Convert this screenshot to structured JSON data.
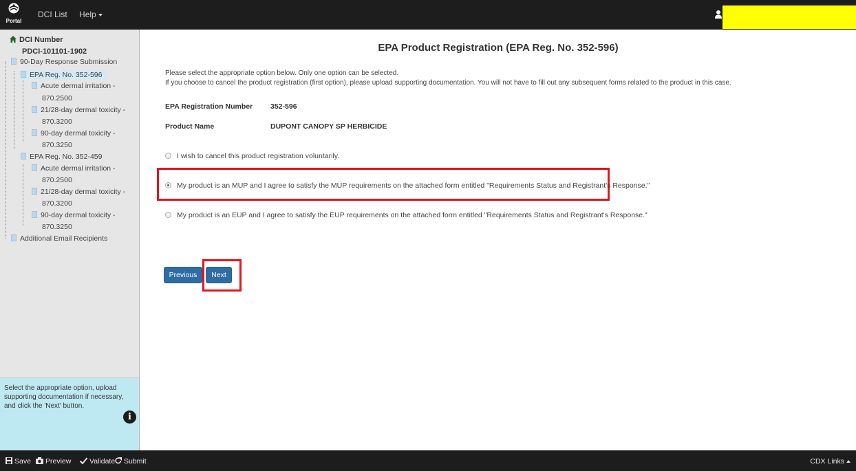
{
  "header": {
    "logo_text": "Portal",
    "nav": [
      {
        "label": "DCI List"
      },
      {
        "label": "Help"
      }
    ]
  },
  "tree": {
    "root_label": "DCI Number",
    "dci_id": "PDCI-101101-1902",
    "submission_label": "90-Day Response Submission",
    "reg1": {
      "label": "EPA Reg. No. 352-596",
      "items": [
        {
          "line1": "Acute dermal irritation -",
          "line2": "870.2500"
        },
        {
          "line1": "21/28-day dermal toxicity -",
          "line2": "870.3200"
        },
        {
          "line1": "90-day dermal toxicity -",
          "line2": "870.3250"
        }
      ]
    },
    "reg2": {
      "label": "EPA Reg. No. 352-459",
      "items": [
        {
          "line1": "Acute dermal irritation -",
          "line2": "870.2500"
        },
        {
          "line1": "21/28-day dermal toxicity -",
          "line2": "870.3200"
        },
        {
          "line1": "90-day dermal toxicity -",
          "line2": "870.3250"
        }
      ]
    },
    "additional_label": "Additional Email Recipients"
  },
  "help": {
    "text": "Select the appropriate option, upload supporting documentation if necessary, and click the 'Next' button.",
    "icon": "info-icon"
  },
  "main": {
    "title": "EPA Product Registration (EPA Reg. No. 352-596)",
    "intro_line1": "Please select the appropriate option below. Only one option can be selected.",
    "intro_line2": "If you choose to cancel the product registration (first option), please upload supporting documentation. You will not have to fill out any subsequent forms related to the product in this case.",
    "reg_number_label": "EPA Registration Number",
    "reg_number_value": "352-596",
    "product_name_label": "Product Name",
    "product_name_value": "DUPONT CANOPY SP HERBICIDE",
    "options": [
      {
        "label": "I wish to cancel this product registration voluntarily.",
        "checked": false
      },
      {
        "label": "My product is an MUP and I agree to satisfy the MUP requirements on the attached form entitled \"Requirements Status and Registrant's Response.\"",
        "checked": true
      },
      {
        "label": "My product is an EUP and I agree to satisfy the EUP requirements on the attached form entitled \"Requirements Status and Registrant's Response.\"",
        "checked": false
      }
    ],
    "previous_label": "Previous",
    "next_label": "Next",
    "highlight_color": "#e0161c",
    "button_color": "#2e6da4"
  },
  "footer": {
    "save_label": "Save",
    "preview_label": "Preview",
    "validate_label": "Validate",
    "submit_label": "Submit",
    "cdx_label": "CDX Links"
  }
}
